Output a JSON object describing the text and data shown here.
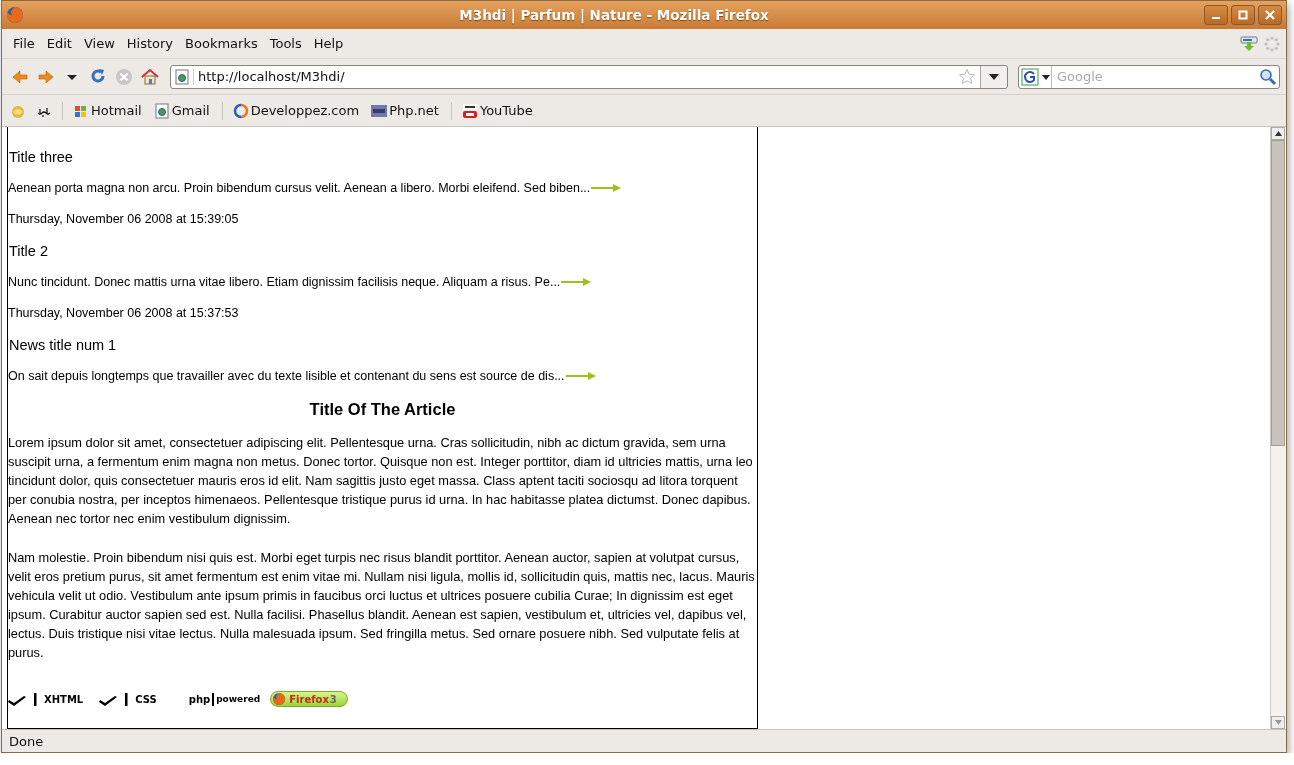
{
  "window": {
    "title": "M3hdi | Parfum | Nature - Mozilla Firefox"
  },
  "menu": [
    {
      "label": "File"
    },
    {
      "label": "Edit"
    },
    {
      "label": "View"
    },
    {
      "label": "History"
    },
    {
      "label": "Bookmarks"
    },
    {
      "label": "Tools"
    },
    {
      "label": "Help"
    }
  ],
  "toolbar": {
    "back_disabled": false,
    "forward_disabled": false,
    "stop_disabled": true,
    "url": "http://localhost/M3hdi/",
    "search": {
      "placeholder": "Google"
    }
  },
  "bookmarks": [
    {
      "kind": "icon-only"
    },
    {
      "kind": "icon-only"
    },
    {
      "kind": "separator"
    },
    {
      "kind": "link",
      "label": "Hotmail"
    },
    {
      "kind": "link",
      "label": "Gmail"
    },
    {
      "kind": "separator"
    },
    {
      "kind": "link",
      "label": "Developpez.com"
    },
    {
      "kind": "link",
      "label": "Php.net"
    },
    {
      "kind": "separator"
    },
    {
      "kind": "link",
      "label": "YouTube"
    }
  ],
  "news": [
    {
      "title": "Title three",
      "excerpt": "Aenean porta magna non arcu. Proin bibendum cursus velit. Aenean a libero. Morbi eleifend. Sed biben...",
      "date": "Thursday, November 06 2008 at 15:39:05"
    },
    {
      "title": "Title 2",
      "excerpt": "Nunc tincidunt. Donec mattis urna vitae libero. Etiam dignissim facilisis neque. Aliquam a risus. Pe...",
      "date": "Thursday, November 06 2008 at 15:37:53"
    },
    {
      "title": "News title num 1",
      "excerpt": "On sait depuis longtemps que travailler avec du texte lisible et contenant du sens est source de dis..."
    }
  ],
  "article": {
    "title": "Title Of The Article",
    "paragraphs": [
      "Lorem ipsum dolor sit amet, consectetuer adipiscing elit. Pellentesque urna. Cras sollicitudin, nibh ac dictum gravida, sem urna suscipit urna, a fermentum enim magna non metus. Donec tortor. Quisque non est. Integer porttitor, diam id ultricies mattis, urna leo tincidunt dolor, quis consectetuer mauris eros id elit. Nam sagittis justo eget massa. Class aptent taciti sociosqu ad litora torquent per conubia nostra, per inceptos himenaeos. Pellentesque tristique purus id urna. In hac habitasse platea dictumst. Donec dapibus. Aenean nec tortor nec enim vestibulum dignissim.",
      "Nam molestie. Proin bibendum nisi quis est. Morbi eget turpis nec risus blandit porttitor. Aenean auctor, sapien at volutpat cursus, velit eros pretium purus, sit amet fermentum est enim vitae mi. Nullam nisi ligula, mollis id, sollicitudin quis, mattis nec, lacus. Mauris vehicula velit ut odio. Vestibulum ante ipsum primis in faucibus orci luctus et ultrices posuere cubilia Curae; In dignissim est eget ipsum. Curabitur auctor sapien sed est. Nulla facilisi. Phasellus blandit. Aenean est sapien, vestibulum et, ultricies vel, dapibus vel, lectus. Duis tristique nisi vitae lectus. Nulla malesuada ipsum. Sed fringilla metus. Sed ornare posuere nibh. Sed vulputate felis at purus."
    ]
  },
  "badges": [
    {
      "kind": "valid",
      "label": "XHTML"
    },
    {
      "kind": "valid",
      "label": "CSS"
    },
    {
      "kind": "php",
      "label": "php",
      "sublabel": "powered"
    },
    {
      "kind": "firefox",
      "label": "Firefox",
      "sublabel": "3"
    }
  ],
  "status_bar": {
    "text": "Done"
  }
}
